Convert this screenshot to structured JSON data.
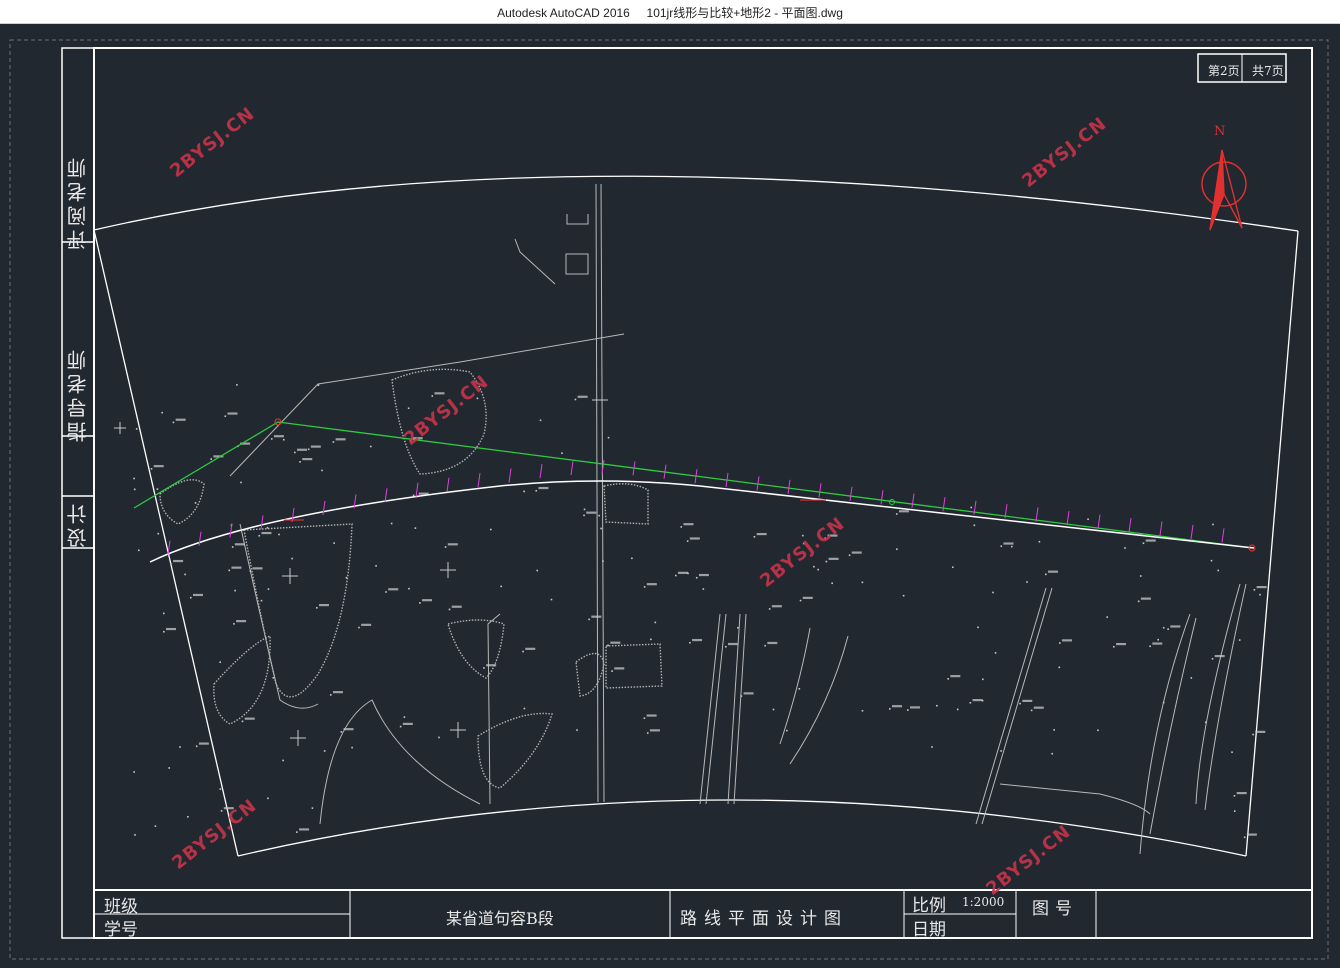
{
  "window": {
    "title": "Autodesk AutoCAD 2016     101jr线形与比较+地形2 - 平面图.dwg"
  },
  "colors": {
    "background": "#212830",
    "frame": "#ffffff",
    "alignment": "#ffffff",
    "comparison_line": "#2ecc40",
    "stations": "#e040e0",
    "annotation": "#ff3030",
    "terrain": "#b8b8b8",
    "watermark": "#c8344a"
  },
  "side_labels": {
    "reviewer": "评阅老师",
    "advisor": "指导老师",
    "designer": "设计"
  },
  "sheet_number": {
    "page": "第2页",
    "total": "共7页"
  },
  "north_arrow": {
    "label": "N",
    "icon": "north-arrow-icon"
  },
  "watermark": "2BYSJ.CN",
  "title_block": {
    "class_label": "班级",
    "student_id_label": "学号",
    "project_name": "某省道句容B段",
    "drawing_name": "路线平面设计图",
    "scale_label": "比例",
    "scale_value": "1:2000",
    "date_label": "日期",
    "drawing_no_label": "图号"
  }
}
